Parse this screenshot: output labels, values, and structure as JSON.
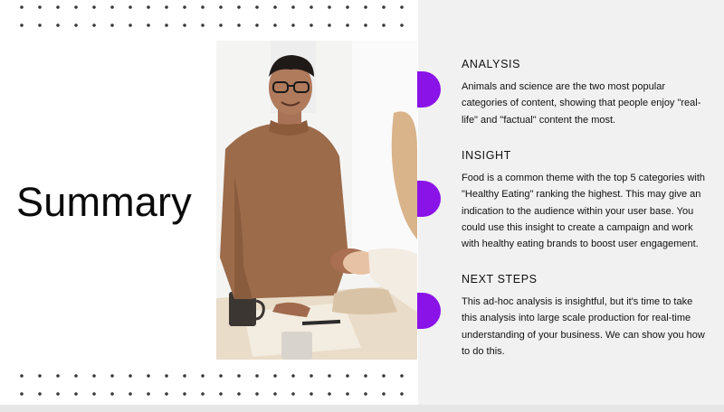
{
  "slide": {
    "title": "Summary",
    "sections": [
      {
        "heading": "ANALYSIS",
        "body": "Animals and science are the two most popular categories of content, showing that people enjoy \"real-life\" and \"factual\" content the most."
      },
      {
        "heading": "INSIGHT",
        "body": "Food is a common theme with the top 5 categories with \"Healthy Eating\" ranking the highest. This may give an indication to the audience within your user base. You could use this insight to create a campaign and work with healthy eating brands to boost user engagement."
      },
      {
        "heading": "NEXT STEPS",
        "body": "This ad-hoc analysis is insightful, but it's time to take this analysis into large scale production for real-time understanding of your business. We can show you how to do this."
      }
    ]
  },
  "colors": {
    "accent": "#8a13e8",
    "panel": "#f1f1f1",
    "background": "#ffffff"
  }
}
